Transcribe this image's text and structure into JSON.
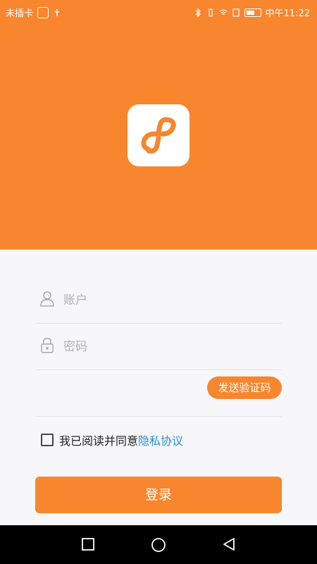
{
  "status_bar": {
    "carrier": "未插卡",
    "time": "中午11:22"
  },
  "logo": {
    "icon": "link-app-logo-icon"
  },
  "form": {
    "account_placeholder": "账户",
    "password_placeholder": "密码",
    "send_code_label": "发送验证码"
  },
  "agreement": {
    "text": "我已阅读并同意",
    "link": "隐私协议"
  },
  "login_label": "登录",
  "colors": {
    "accent": "#f7862e",
    "link": "#2a8fd1"
  }
}
